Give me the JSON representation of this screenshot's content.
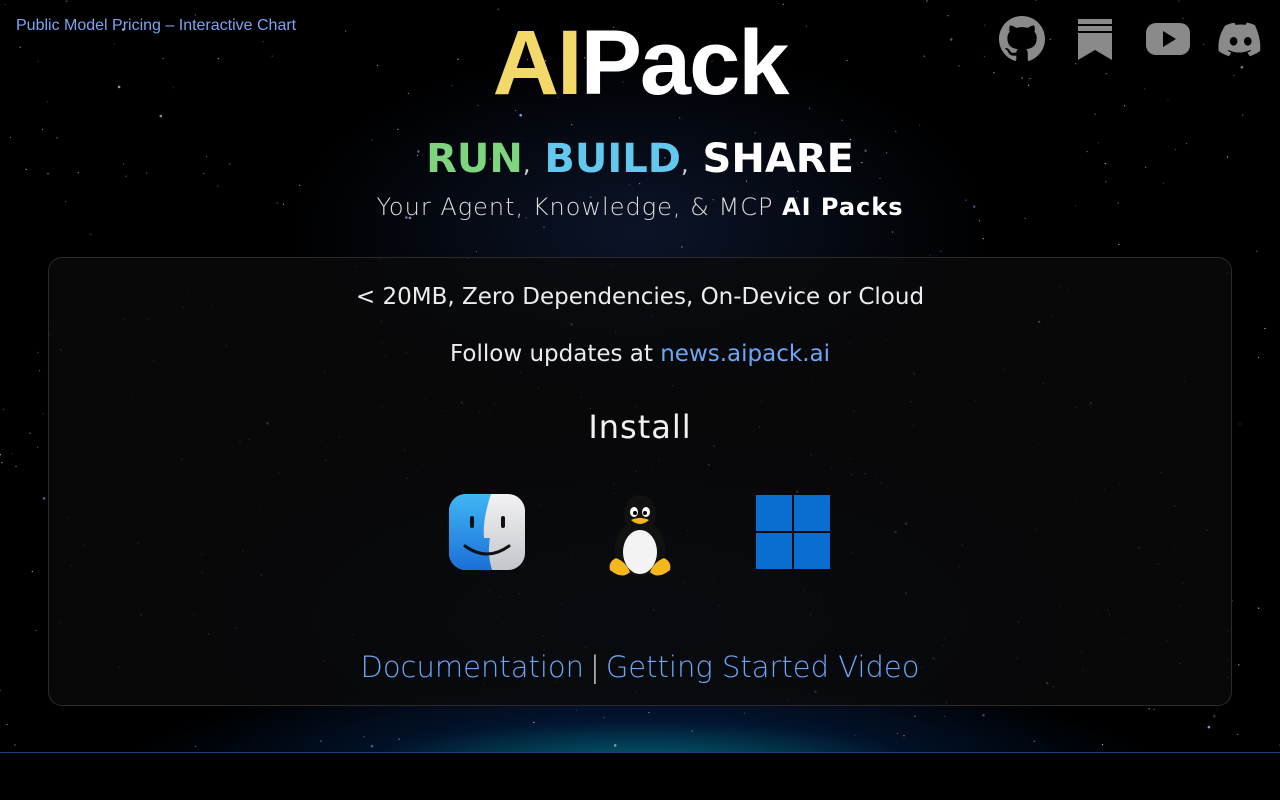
{
  "header": {
    "top_link": "Public Model Pricing – Interactive Chart",
    "logo_ai": "AI",
    "logo_pack": "Pack",
    "social_icons": [
      "github-icon",
      "bookmark-icon",
      "youtube-icon",
      "discord-icon"
    ]
  },
  "tagline": {
    "run": "RUN",
    "build": "BUILD",
    "share": "SHARE",
    "separator": ","
  },
  "subtitle": {
    "text": "Your Agent, Knowledge, & MCP ",
    "strong": "AI Packs"
  },
  "panel": {
    "features": "< 20MB, Zero Dependencies, On-Device or Cloud",
    "updates_prefix": "Follow updates at ",
    "updates_link": "news.aipack.ai",
    "install_title": "Install",
    "os_icons": [
      "macos-finder-icon",
      "linux-tux-icon",
      "windows-icon"
    ],
    "documentation_link": "Documentation",
    "separator": "|",
    "video_link": "Getting Started Video"
  },
  "colors": {
    "ai_yellow": "#f3d86a",
    "run_green": "#7fd47f",
    "build_blue": "#62c8ee",
    "link_blue": "#6ea6f4"
  }
}
